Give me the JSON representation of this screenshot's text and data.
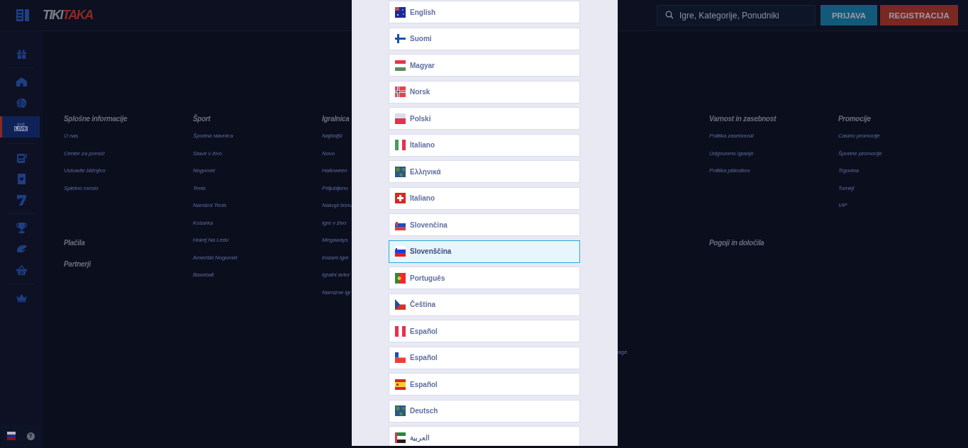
{
  "logo": {
    "first": "TIKI",
    "second": "TAKA"
  },
  "search": {
    "placeholder": "Igre, Kategorije, Ponudniki"
  },
  "buttons": [
    {
      "kind": "login",
      "label": "PRIJAVA"
    },
    {
      "kind": "register",
      "label": "REGISTRACIJA"
    }
  ],
  "sidebar": {
    "items": [
      {
        "kind": "gift",
        "selected": false
      },
      {
        "kind": "home",
        "selected": false
      },
      {
        "kind": "ball",
        "selected": false
      },
      {
        "kind": "live",
        "label": "LIVE",
        "selected": true
      },
      {
        "kind": "slot",
        "selected": false
      },
      {
        "kind": "card",
        "selected": false
      },
      {
        "kind": "seven",
        "selected": false
      },
      {
        "kind": "trophy",
        "selected": false
      },
      {
        "kind": "rugby",
        "selected": false
      },
      {
        "kind": "basket",
        "selected": false
      },
      {
        "kind": "crown",
        "selected": false
      }
    ],
    "help": "?"
  },
  "footer": {
    "columns": [
      {
        "heading": "Splošne informacije",
        "links": [
          "O nas",
          "Center za pomoč",
          "Ustvarite bližnjico",
          "Spletno mesto"
        ],
        "more": [
          "Plačila",
          "Partnerji"
        ]
      },
      {
        "heading": "Šport",
        "links": [
          "Športna stavnica",
          "Stave v živo",
          "Nogomet",
          "Tenis",
          "Namizni Tenis",
          "Košarka",
          "Hokej Na Ledu",
          "Ameriški Nogomet",
          "Baseball"
        ]
      },
      {
        "heading": "Igralnica",
        "links": [
          "Najboljši",
          "Novo",
          "Halloween",
          "Priljubljeno",
          "Nakupi bonu",
          "Igre v živo",
          "Megaways",
          "Instant Igre",
          "Igralni avtor",
          "Namizne igr"
        ]
      },
      {
        "heading": "Varnost in zasebnost",
        "links": [
          "Politika zasebnosti",
          "Odgovorno igranje",
          "Politika piškotkov"
        ],
        "more": [
          "Pogoji in določila"
        ]
      },
      {
        "heading": "Promocije",
        "links": [
          "Casino promocije",
          "Športne promocije",
          "Trgovina",
          "Turnirji",
          "VIP"
        ]
      }
    ],
    "note": "age."
  },
  "languages": [
    {
      "kind": "australia",
      "label": "English",
      "selected": false
    },
    {
      "kind": "finland",
      "label": "Suomi",
      "selected": false
    },
    {
      "kind": "hungary",
      "label": "Magyar",
      "selected": false
    },
    {
      "kind": "norway",
      "label": "Norsk",
      "selected": false
    },
    {
      "kind": "poland",
      "label": "Polski",
      "selected": false
    },
    {
      "kind": "italy",
      "label": "Italiano",
      "selected": false
    },
    {
      "kind": "globe",
      "label": "Ελληνικά",
      "selected": false
    },
    {
      "kind": "switzerland",
      "label": "Italiano",
      "selected": false
    },
    {
      "kind": "slovakia",
      "label": "Slovenčina",
      "selected": false
    },
    {
      "kind": "slovenia",
      "label": "Slovenščina",
      "selected": true
    },
    {
      "kind": "portugal",
      "label": "Português",
      "selected": false
    },
    {
      "kind": "czechia",
      "label": "Čeština",
      "selected": false
    },
    {
      "kind": "peru",
      "label": "Español",
      "selected": false
    },
    {
      "kind": "chile",
      "label": "Español",
      "selected": false
    },
    {
      "kind": "spain",
      "label": "Español",
      "selected": false
    },
    {
      "kind": "globe",
      "label": "Deutsch",
      "selected": false
    },
    {
      "kind": "emirates",
      "label": "العربية",
      "selected": false
    }
  ]
}
